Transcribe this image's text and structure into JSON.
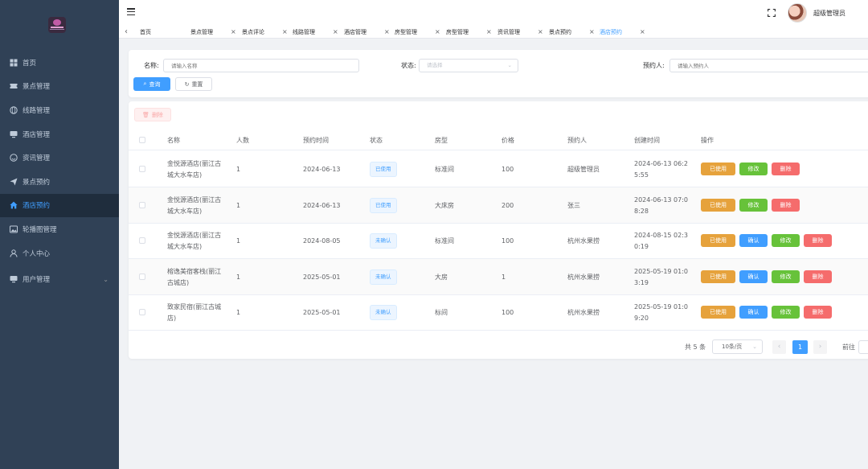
{
  "user": {
    "name": "超级管理员"
  },
  "sidebar": {
    "items": [
      {
        "label": "首页",
        "icon": "dashboard-icon"
      },
      {
        "label": "景点管理",
        "icon": "ticket-icon"
      },
      {
        "label": "线路管理",
        "icon": "globe-icon"
      },
      {
        "label": "酒店管理",
        "icon": "monitor-icon"
      },
      {
        "label": "资讯管理",
        "icon": "smile-icon"
      },
      {
        "label": "景点预约",
        "icon": "send-icon"
      },
      {
        "label": "酒店预约",
        "icon": "home-icon",
        "active": true
      },
      {
        "label": "轮播图管理",
        "icon": "image-icon"
      },
      {
        "label": "个人中心",
        "icon": "user-icon"
      },
      {
        "label": "用户管理",
        "icon": "monitor-icon",
        "submenu": true
      }
    ]
  },
  "tabs": [
    {
      "label": "首页"
    },
    {
      "label": "景点管理"
    },
    {
      "label": "景点评论"
    },
    {
      "label": "线路管理"
    },
    {
      "label": "酒店管理"
    },
    {
      "label": "房型管理"
    },
    {
      "label": "房型管理"
    },
    {
      "label": "资讯管理"
    },
    {
      "label": "景点预约"
    },
    {
      "label": "酒店预约",
      "active": true
    }
  ],
  "search": {
    "name_label": "名称:",
    "name_placeholder": "请输入名称",
    "status_label": "状态:",
    "status_placeholder": "请选择",
    "booker_label": "预约人:",
    "booker_placeholder": "请输入预约人",
    "query_label": "查询",
    "reset_label": "重置"
  },
  "toolbar": {
    "delete_label": "删除"
  },
  "table": {
    "columns": [
      "名称",
      "人数",
      "预约时间",
      "状态",
      "房型",
      "价格",
      "预约人",
      "创建时间",
      "操作"
    ],
    "rows": [
      {
        "name": [
          "金悦源酒店(丽江古",
          "城大水车店)"
        ],
        "people": "1",
        "date": "2024-06-13",
        "status": "已使用",
        "room": "标准间",
        "price": "100",
        "booker": "超级管理员",
        "created": [
          "2024-06-13 06:2",
          "5:55"
        ],
        "actions": [
          "已使用",
          "修改",
          "删除"
        ]
      },
      {
        "name": [
          "金悦源酒店(丽江古",
          "城大水车店)"
        ],
        "people": "1",
        "date": "2024-06-13",
        "status": "已使用",
        "room": "大床房",
        "price": "200",
        "booker": "张三",
        "created": [
          "2024-06-13 07:0",
          "8:28"
        ],
        "actions": [
          "已使用",
          "修改",
          "删除"
        ]
      },
      {
        "name": [
          "金悦源酒店(丽江古",
          "城大水车店)"
        ],
        "people": "1",
        "date": "2024-08-05",
        "status": "未确认",
        "room": "标准间",
        "price": "100",
        "booker": "杭州水果捞",
        "created": [
          "2024-08-15 02:3",
          "0:19"
        ],
        "actions": [
          "已使用",
          "确认",
          "修改",
          "删除"
        ]
      },
      {
        "name": [
          "榕逸美宿客栈(丽江",
          "古城店)"
        ],
        "people": "1",
        "date": "2025-05-01",
        "status": "未确认",
        "room": "大房",
        "price": "1",
        "booker": "杭州水果捞",
        "created": [
          "2025-05-19 01:0",
          "3:19"
        ],
        "actions": [
          "已使用",
          "确认",
          "修改",
          "删除"
        ]
      },
      {
        "name": [
          "致家民宿(丽江古城",
          "店)"
        ],
        "people": "1",
        "date": "2025-05-01",
        "status": "未确认",
        "room": "标间",
        "price": "100",
        "booker": "杭州水果捞",
        "created": [
          "2025-05-19 01:0",
          "9:20"
        ],
        "actions": [
          "已使用",
          "确认",
          "修改",
          "删除"
        ]
      }
    ]
  },
  "pagination": {
    "total": "共 5 条",
    "page_size": "10条/页",
    "current": "1",
    "goto": "前往"
  }
}
